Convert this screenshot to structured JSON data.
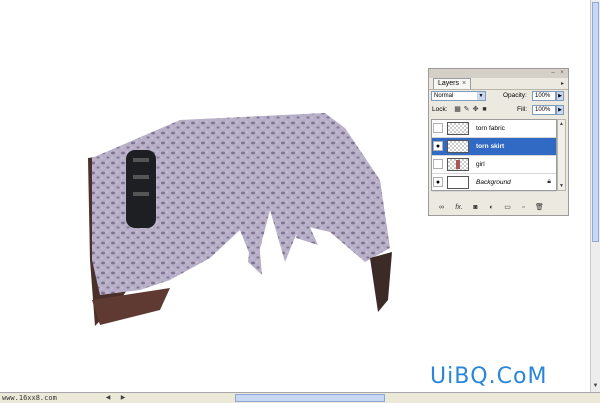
{
  "layers_panel": {
    "tab_label": "Layers",
    "close_glyph": "×",
    "blend_mode": "Normal",
    "opacity_label": "Opacity:",
    "opacity_value": "100%",
    "lock_label": "Lock:",
    "fill_label": "Fill:",
    "fill_value": "100%",
    "layers": [
      {
        "name": "torn fabric",
        "visible": false,
        "selected": false
      },
      {
        "name": "torn skirt",
        "visible": true,
        "selected": true
      },
      {
        "name": "girl",
        "visible": false,
        "selected": false
      },
      {
        "name": "Background",
        "visible": true,
        "selected": false,
        "locked": true
      }
    ],
    "footer_icons": [
      "link-icon",
      "fx-icon",
      "mask-icon",
      "adjustment-icon",
      "group-icon",
      "new-layer-icon",
      "trash-icon"
    ],
    "fx_label": "fx."
  },
  "statusbar": {
    "text": "www.16xx8.com"
  },
  "watermark": "UiBQ.CoM",
  "colors": {
    "selection": "#316ac5",
    "watermark": "#2a86d8",
    "fabric": "#b9afc9"
  }
}
